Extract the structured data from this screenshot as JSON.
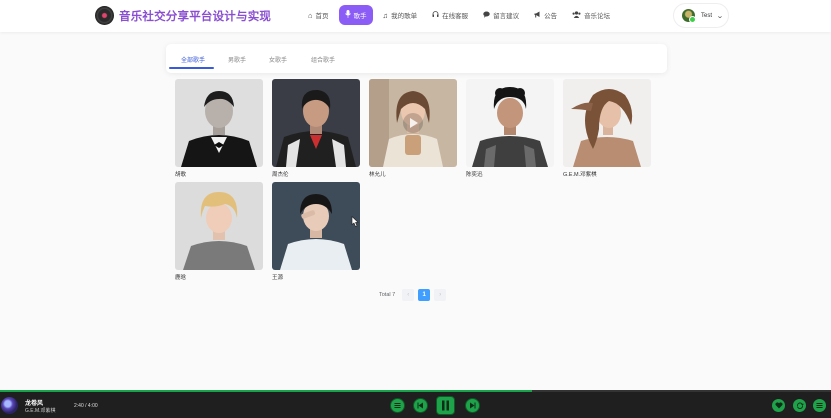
{
  "header": {
    "site_title": "音乐社交分享平台设计与实现",
    "nav": [
      {
        "label": "首页",
        "icon": "home-icon"
      },
      {
        "label": "歌手",
        "icon": "microphone-icon",
        "active": true
      },
      {
        "label": "我的歌单",
        "icon": "music-note-icon"
      },
      {
        "label": "在线客服",
        "icon": "headset-icon"
      },
      {
        "label": "留言建议",
        "icon": "comment-icon"
      },
      {
        "label": "公告",
        "icon": "megaphone-icon"
      },
      {
        "label": "音乐论坛",
        "icon": "users-icon"
      }
    ],
    "user": {
      "name": "Test"
    }
  },
  "tabs": [
    {
      "label": "全部歌手",
      "active": true
    },
    {
      "label": "男歌手"
    },
    {
      "label": "女歌手"
    },
    {
      "label": "组合歌手"
    }
  ],
  "singers": [
    {
      "name": "胡歌"
    },
    {
      "name": "周杰伦"
    },
    {
      "name": "林允儿"
    },
    {
      "name": "陈奕迅"
    },
    {
      "name": "G.E.M.邓紫棋"
    },
    {
      "name": "鹿晗"
    },
    {
      "name": "王源"
    }
  ],
  "pagination": {
    "total_label": "Total 7",
    "current_page": "1",
    "prev": "‹",
    "next": "›"
  },
  "player": {
    "song_title": "龙卷风",
    "artist": "G.E.M.邓紫棋",
    "time": "2:40 / 4:00",
    "progress": 0.64
  },
  "colors": {
    "accent": "#8b5cf6",
    "tab_active": "#3a5bd9",
    "page_current": "#409eff",
    "player_green": "#1ea34a"
  }
}
